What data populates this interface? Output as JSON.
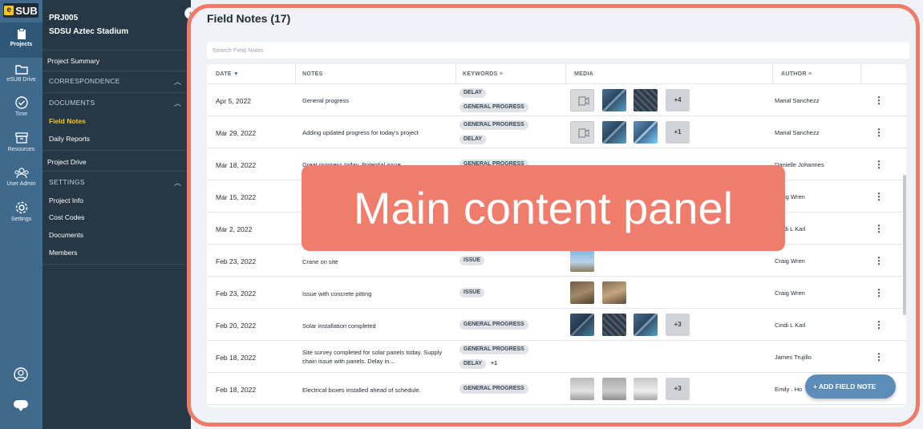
{
  "rail": {
    "logo": "SUB",
    "items": [
      "Projects",
      "eSUB Drive",
      "Time",
      "Resources",
      "User Admin",
      "Settings"
    ]
  },
  "sidebar": {
    "project_code": "PRJ005",
    "project_name": "SDSU Aztec Stadium",
    "project_summary": "Project Summary",
    "correspondence": "CORRESPONDENCE",
    "documents": "DOCUMENTS",
    "field_notes": "Field Notes",
    "daily_reports": "Daily Reports",
    "project_drive": "Project Drive",
    "settings": "SETTINGS",
    "project_info": "Project Info",
    "cost_codes": "Cost Codes",
    "documents_item": "Documents",
    "members": "Members"
  },
  "main": {
    "title": "Field Notes (17)",
    "search_placeholder": "Search Field Notes",
    "columns": [
      "DATE",
      "NOTES",
      "KEYWORDS",
      "MEDIA",
      "AUTHOR"
    ],
    "add_button": "+ ADD FIELD NOTE",
    "rows": [
      {
        "date": "Apr 5, 2022",
        "note": "General progress",
        "keywords": [
          "DELAY",
          "GENERAL PROGRESS"
        ],
        "more": "+4",
        "author": "Marial Sanchezz"
      },
      {
        "date": "Mar 29, 2022",
        "note": "Adding updated progress for today's project",
        "keywords": [
          "GENERAL PROGRESS",
          "DELAY"
        ],
        "more": "+1",
        "author": "Marial Sanchezz"
      },
      {
        "date": "Mar 18, 2022",
        "note": "Great progress today. Potential issue",
        "keywords": [
          "GENERAL PROGRESS"
        ],
        "more": "",
        "author": "Danielle Johannes"
      },
      {
        "date": "Mar 15, 2022",
        "note": "",
        "keywords": [],
        "more": "",
        "author": "Craig Wren"
      },
      {
        "date": "Mar 2, 2022",
        "note": "",
        "keywords": [],
        "more": "",
        "author": "Cindi L Karl"
      },
      {
        "date": "Feb 23, 2022",
        "note": "Crane on site",
        "keywords": [
          "ISSUE"
        ],
        "more": "",
        "author": "Craig Wren"
      },
      {
        "date": "Feb 23, 2022",
        "note": "Issue with concrete pitting",
        "keywords": [
          "ISSUE"
        ],
        "more": "",
        "author": "Craig Wren"
      },
      {
        "date": "Feb 20, 2022",
        "note": "Solar installation completed",
        "keywords": [
          "GENERAL PROGRESS"
        ],
        "more": "+3",
        "author": "Cindi L Karl"
      },
      {
        "date": "Feb 18, 2022",
        "note": "Site survey completed for solar panels today. Supply chain issue with panels. Delay in...",
        "keywords": [
          "GENERAL PROGRESS",
          "DELAY"
        ],
        "kw_more": "+1",
        "more": "",
        "author": "James Trujillo"
      },
      {
        "date": "Feb 18, 2022",
        "note": "Electrical boxes installed ahead of schedule.",
        "keywords": [
          "GENERAL PROGRESS"
        ],
        "more": "+3",
        "author": "Emily . Ho"
      }
    ]
  },
  "annotation": {
    "label": "Main content panel",
    "color": "#ee7b6a"
  }
}
